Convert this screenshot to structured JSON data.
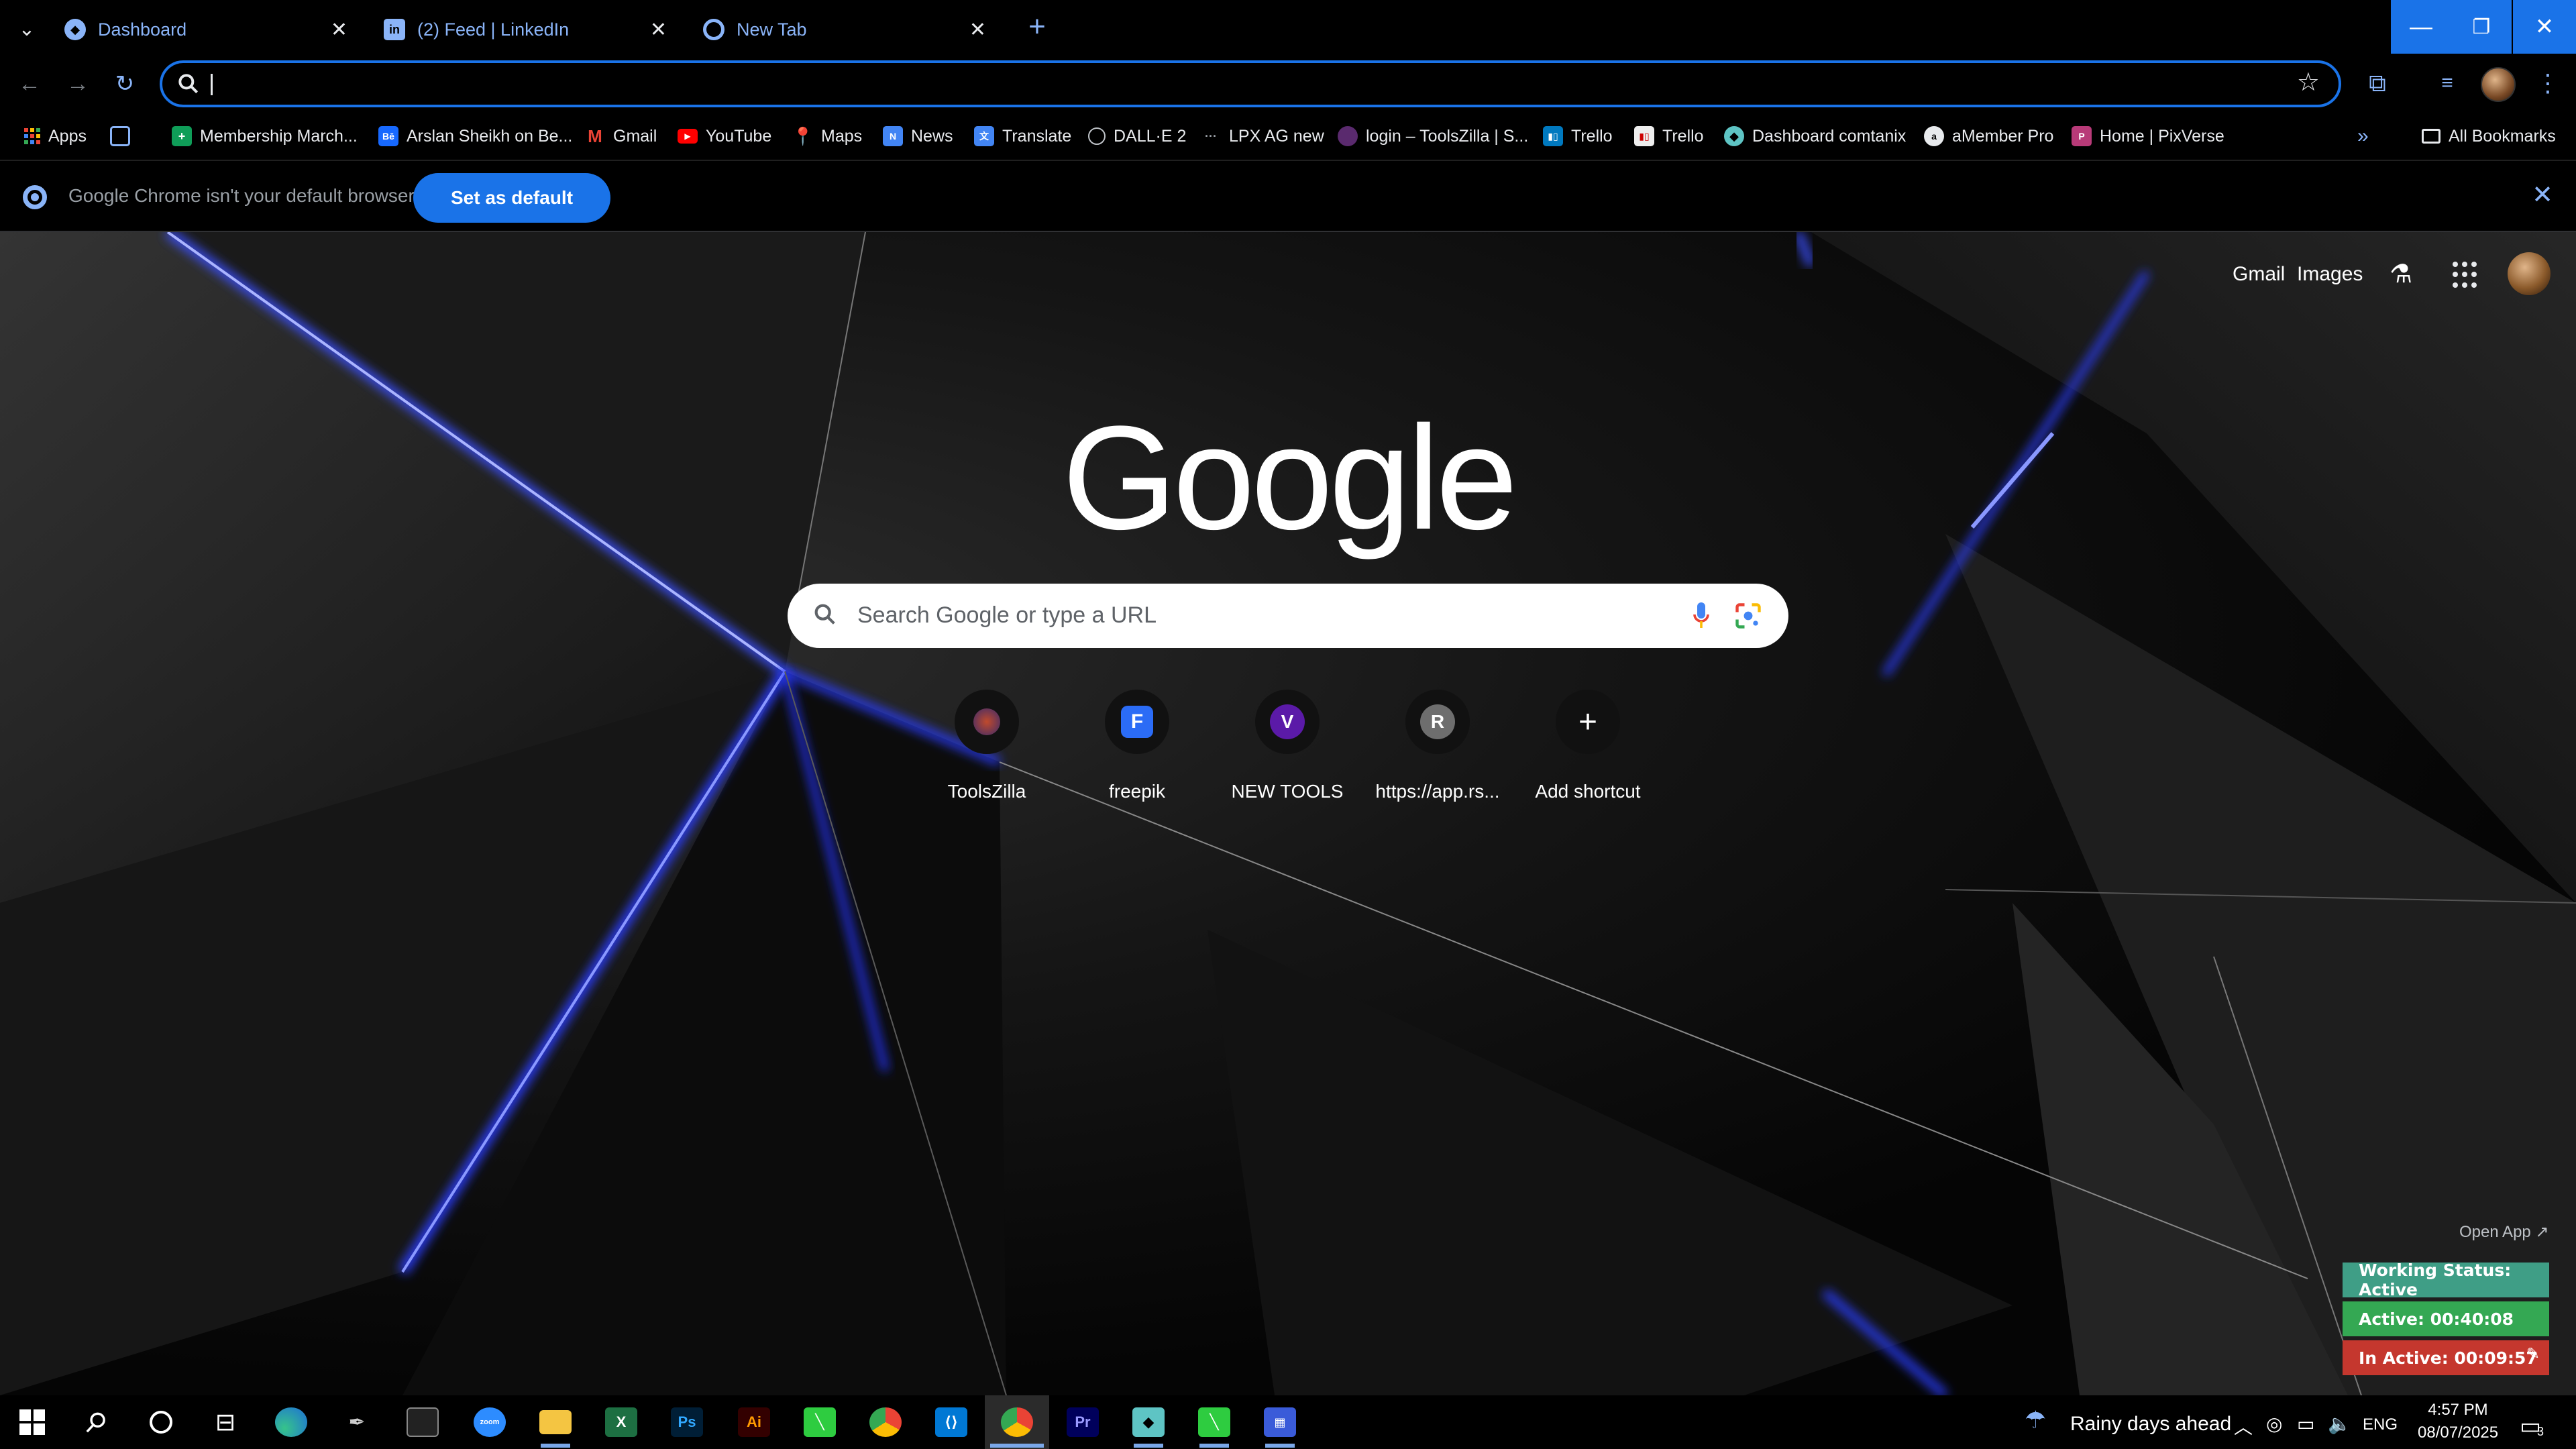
{
  "tabs": [
    {
      "label": "Dashboard",
      "icon": "dashboard-favicon"
    },
    {
      "label": "(2) Feed | LinkedIn",
      "icon": "linkedin-favicon"
    },
    {
      "label": "New Tab",
      "icon": "chrome-favicon"
    }
  ],
  "bookmarks": [
    {
      "label": "Apps",
      "icon": "apps-grid-icon"
    },
    {
      "label": "Membership March...",
      "icon": "green-doc-icon"
    },
    {
      "label": "Arslan Sheikh on Be...",
      "icon": "behance-icon"
    },
    {
      "label": "Gmail",
      "icon": "gmail-icon"
    },
    {
      "label": "YouTube",
      "icon": "youtube-icon"
    },
    {
      "label": "Maps",
      "icon": "maps-icon"
    },
    {
      "label": "News",
      "icon": "news-icon"
    },
    {
      "label": "Translate",
      "icon": "translate-icon"
    },
    {
      "label": "DALL·E 2",
      "icon": "openai-icon"
    },
    {
      "label": "LPX AG new",
      "icon": "dots-icon"
    },
    {
      "label": "login – ToolsZilla | S...",
      "icon": "toolszilla-icon"
    },
    {
      "label": "Trello",
      "icon": "trello-icon"
    },
    {
      "label": "Trello",
      "icon": "trello-icon"
    },
    {
      "label": "Dashboard comtanix",
      "icon": "dashboard-favicon"
    },
    {
      "label": "aMember Pro",
      "icon": "amember-icon"
    },
    {
      "label": "Home | PixVerse",
      "icon": "pixverse-icon"
    }
  ],
  "all_bookmarks": "All Bookmarks",
  "infobar": {
    "message": "Google Chrome isn't your default browser",
    "button": "Set as default"
  },
  "ntp": {
    "gmail": "Gmail",
    "images": "Images",
    "logo": "Google",
    "search_placeholder": "Search Google or type a URL",
    "shortcuts": [
      {
        "label": "ToolsZilla",
        "letter": "",
        "color": "#3b2a6b"
      },
      {
        "label": "freepik",
        "letter": "",
        "color": "#2b6cf6"
      },
      {
        "label": "NEW TOOLS",
        "letter": "V",
        "color": "#5b1aa8"
      },
      {
        "label": "https://app.rs...",
        "letter": "R",
        "color": "#6e6e6e"
      },
      {
        "label": "Add shortcut",
        "letter": "+",
        "color": "#111111"
      }
    ]
  },
  "widget": {
    "open_app": "Open App ↗",
    "status": "Working Status: Active",
    "active": "Active: 00:40:08",
    "inactive": "In Active: 00:09:57",
    "colors": {
      "status": "#3f9e86",
      "active": "#34a853",
      "inactive": "#c5372e"
    }
  },
  "tray": {
    "weather": "Rainy days ahead",
    "lang": "ENG",
    "time": "4:57 PM",
    "date": "08/07/2025",
    "notifications": "3"
  }
}
